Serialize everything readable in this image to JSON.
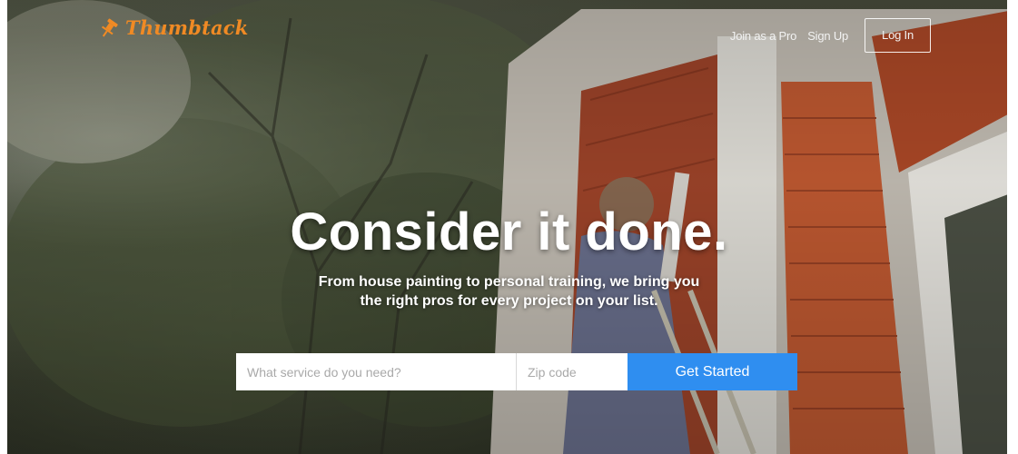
{
  "brand": {
    "name": "Thumbtack",
    "logo_icon": "pushpin-icon",
    "color": "#f08a24"
  },
  "header": {
    "join_link": "Join as a Pro",
    "signup_link": "Sign Up",
    "login_button": "Log In"
  },
  "hero": {
    "headline": "Consider it done.",
    "subline_1": "From house painting to personal training, we bring you",
    "subline_2": "the right pros for every project on your list."
  },
  "search": {
    "service_placeholder": "What service do you need?",
    "service_value": "",
    "zip_placeholder": "Zip code",
    "zip_value": "",
    "submit_label": "Get Started",
    "submit_color": "#2f8ef0"
  }
}
